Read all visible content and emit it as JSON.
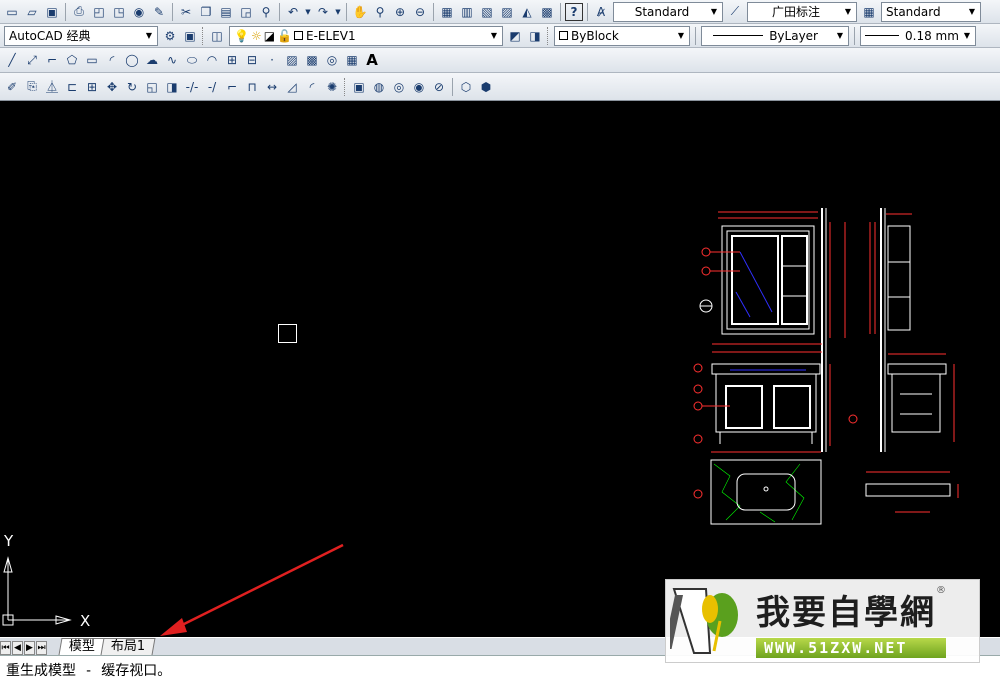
{
  "toolbar": {
    "text_style": "Standard",
    "dim_style": "广田标注",
    "table_style": "Standard",
    "workspace": "AutoCAD 经典",
    "layer": "E-ELEV1",
    "color": "ByBlock",
    "linetype": "ByLayer",
    "lineweight": "0.18 mm",
    "text_tool": "A"
  },
  "ucs": {
    "y_label": "Y",
    "x_label": "X"
  },
  "layout_tabs": [
    {
      "label": "模型",
      "active": true
    },
    {
      "label": "布局1",
      "active": false
    }
  ],
  "command_line": {
    "text": "重生成模型 - 缓存视口。"
  },
  "watermark": {
    "title": "我要自學網",
    "url": "WWW.51ZXW.NET",
    "mark": "®"
  },
  "colors": {
    "drawing_line": "#ffffff",
    "dimension": "#ff3030",
    "hatch": "#00ff00",
    "accent": "#3030ff",
    "arrow": "#e02020"
  }
}
